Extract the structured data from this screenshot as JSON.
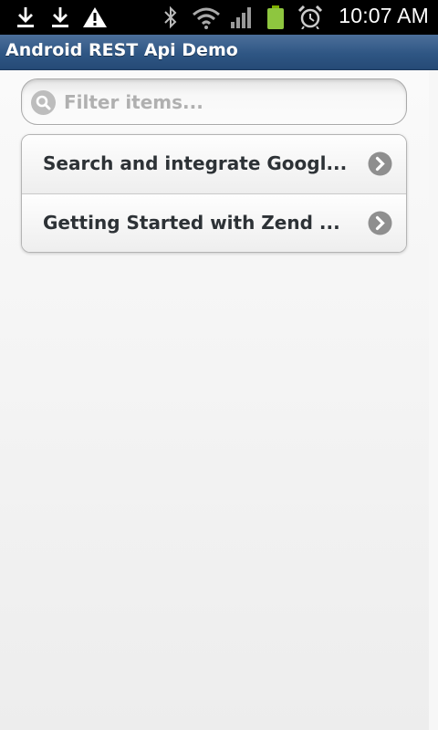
{
  "status_bar": {
    "time": "10:07 AM",
    "left_icons": [
      "download-icon",
      "download-icon",
      "warning-icon"
    ],
    "right_icons": [
      "bluetooth-icon",
      "wifi-icon",
      "signal-icon",
      "battery-icon",
      "alarm-icon"
    ]
  },
  "app": {
    "title": "Android REST Api Demo"
  },
  "search": {
    "placeholder": "Filter items..."
  },
  "list": {
    "items": [
      {
        "label": "Search and integrate Googl..."
      },
      {
        "label": "Getting Started with Zend ..."
      }
    ]
  },
  "colors": {
    "title_bar": "#2f5684",
    "item_text": "#2d3236",
    "chevron": "#8f8f8f"
  }
}
